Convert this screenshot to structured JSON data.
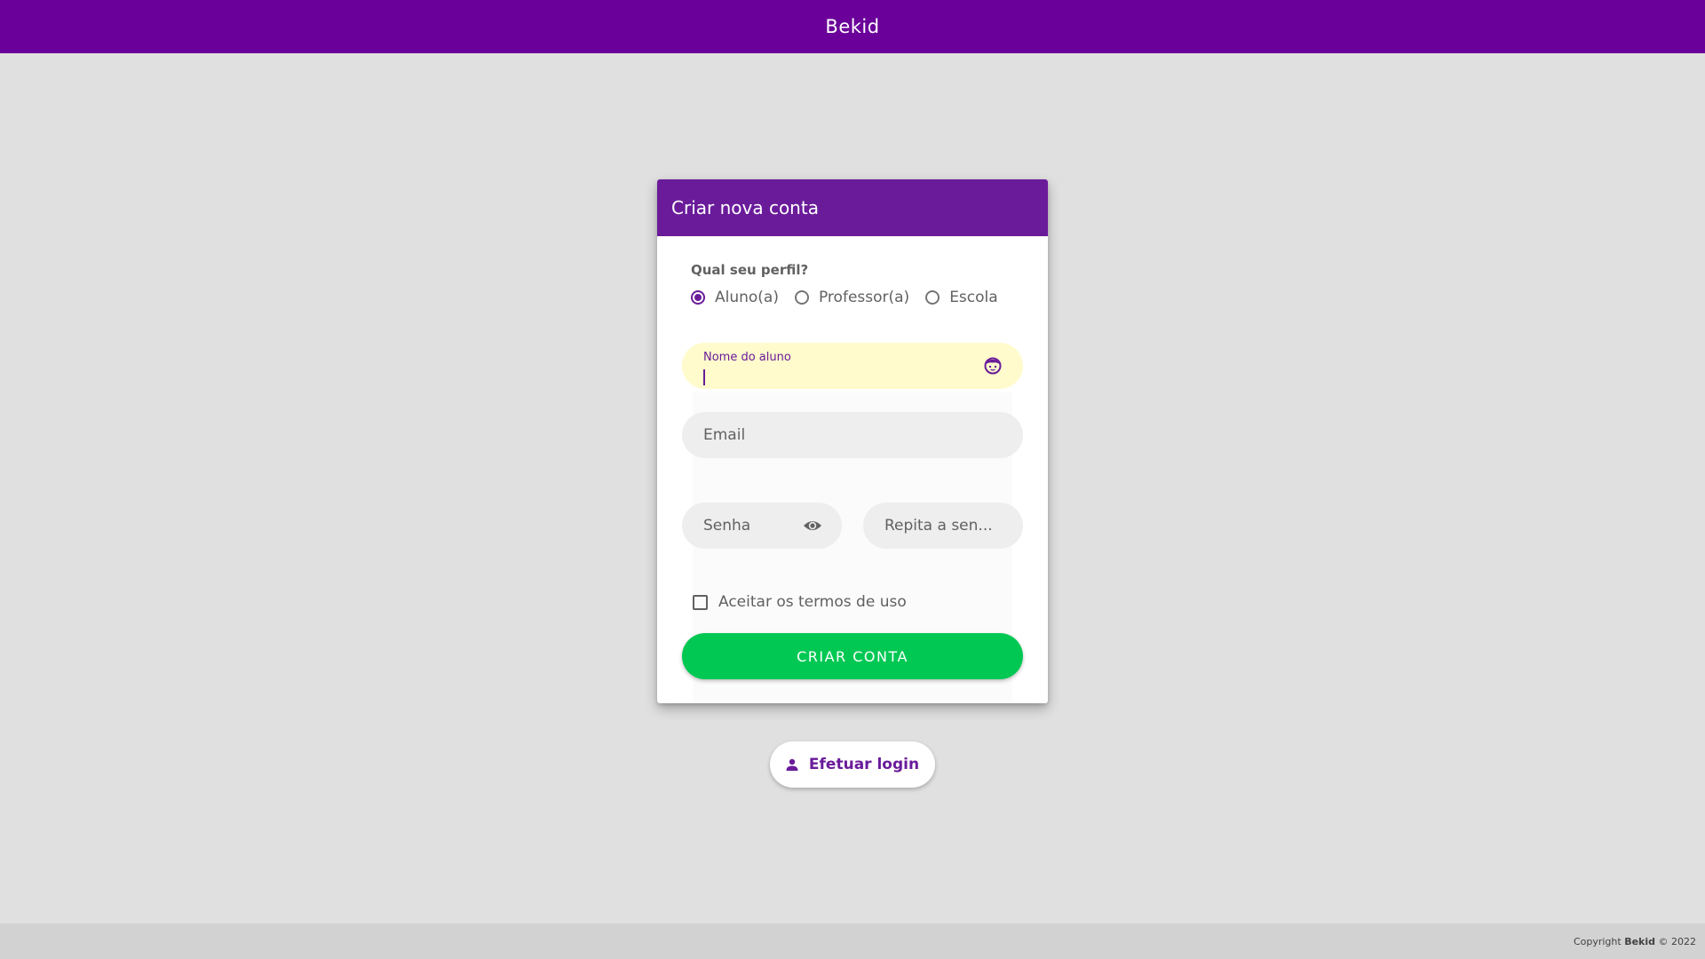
{
  "app": {
    "title": "Bekid"
  },
  "card": {
    "title": "Criar nova conta",
    "profile_question": "Qual seu perfil?",
    "profiles": [
      {
        "label": "Aluno(a)",
        "checked": true
      },
      {
        "label": "Professor(a)",
        "checked": false
      },
      {
        "label": "Escola",
        "checked": false
      }
    ],
    "name_field": {
      "label": "Nome do aluno",
      "value": "",
      "icon": "child-face-icon"
    },
    "email_field": {
      "placeholder": "Email",
      "value": ""
    },
    "password_field": {
      "placeholder": "Senha",
      "value": "",
      "icon": "eye-icon"
    },
    "repeat_password_field": {
      "placeholder": "Repita a sen...",
      "value": ""
    },
    "terms": {
      "label": "Aceitar os termos de uso",
      "checked": false
    },
    "submit_label": "CRIAR CONTA"
  },
  "login": {
    "label": "Efetuar login",
    "icon": "person-icon"
  },
  "footer": {
    "prefix": "Copyright",
    "brand": "Bekid",
    "suffix": "© 2022"
  },
  "colors": {
    "primary": "#6a0099",
    "card_header": "#6a1b9a",
    "accent_green": "#00c853",
    "active_field_bg": "#fffbcc"
  }
}
